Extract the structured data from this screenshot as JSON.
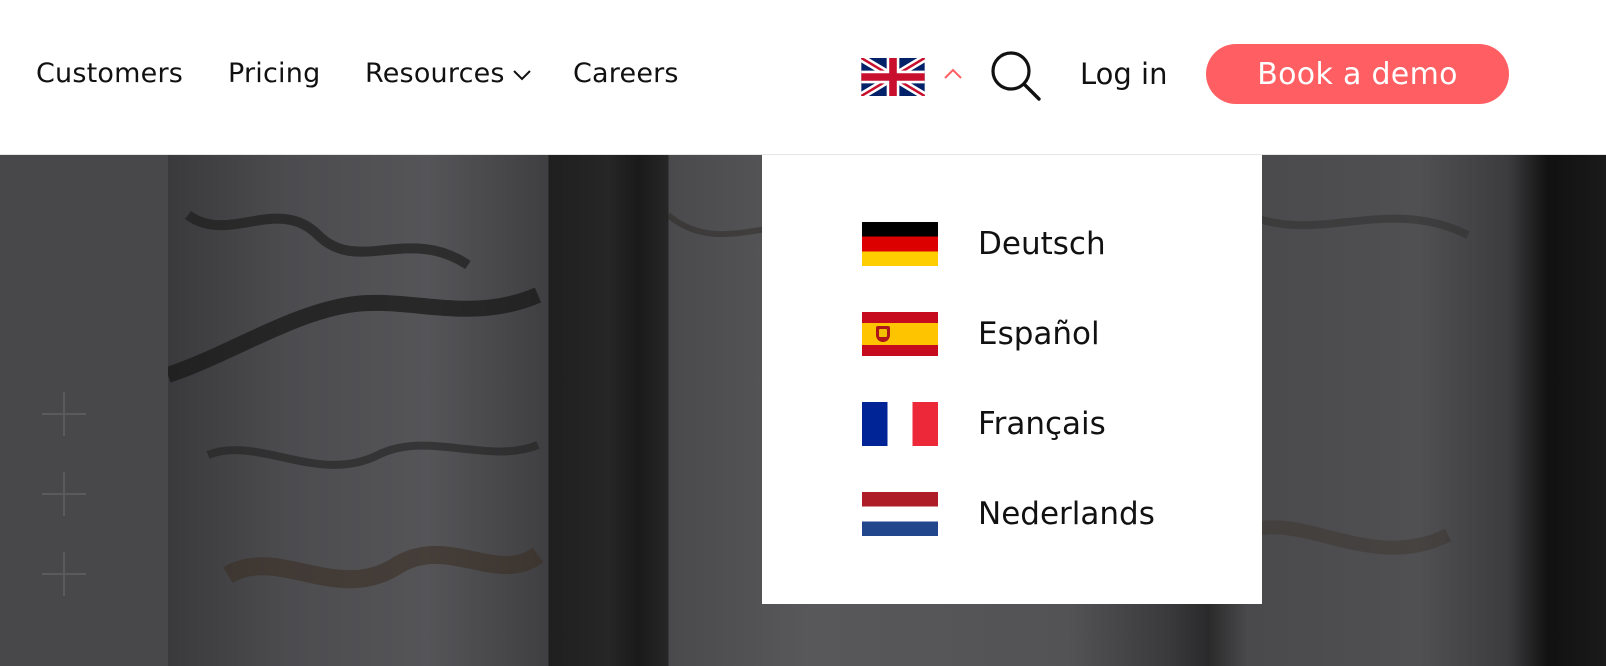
{
  "nav": {
    "customers": "Customers",
    "pricing": "Pricing",
    "resources": "Resources",
    "careers": "Careers"
  },
  "header": {
    "current_language_icon": "uk-flag-icon",
    "login": "Log in",
    "cta": "Book a demo"
  },
  "language_menu": {
    "items": [
      {
        "label": "Deutsch",
        "icon": "german-flag-icon"
      },
      {
        "label": "Español",
        "icon": "spanish-flag-icon"
      },
      {
        "label": "Français",
        "icon": "french-flag-icon"
      },
      {
        "label": "Nederlands",
        "icon": "dutch-flag-icon"
      }
    ]
  },
  "colors": {
    "accent": "#ff5f63",
    "header_bg": "#ffffff",
    "text": "#111111"
  }
}
